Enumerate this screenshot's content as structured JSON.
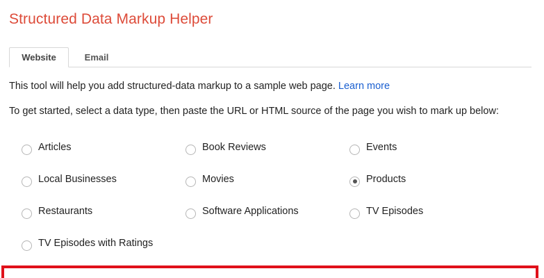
{
  "title": "Structured Data Markup Helper",
  "tabs": [
    {
      "label": "Website",
      "active": true
    },
    {
      "label": "Email",
      "active": false
    }
  ],
  "intro": {
    "text": "This tool will help you add structured-data markup to a sample web page.",
    "link": "Learn more"
  },
  "instructions": "To get started, select a data type, then paste the URL or HTML source of the page you wish to mark up below:",
  "data_types": [
    {
      "label": "Articles",
      "checked": false
    },
    {
      "label": "Book Reviews",
      "checked": false
    },
    {
      "label": "Events",
      "checked": false
    },
    {
      "label": "Local Businesses",
      "checked": false
    },
    {
      "label": "Movies",
      "checked": false
    },
    {
      "label": "Products",
      "checked": true
    },
    {
      "label": "Restaurants",
      "checked": false
    },
    {
      "label": "Software Applications",
      "checked": false
    },
    {
      "label": "TV Episodes",
      "checked": false
    },
    {
      "label": "TV Episodes with Ratings",
      "checked": false
    }
  ],
  "colors": {
    "title": "#dd4b39",
    "link": "#1a5fd0",
    "highlight_border": "#e0101a"
  }
}
